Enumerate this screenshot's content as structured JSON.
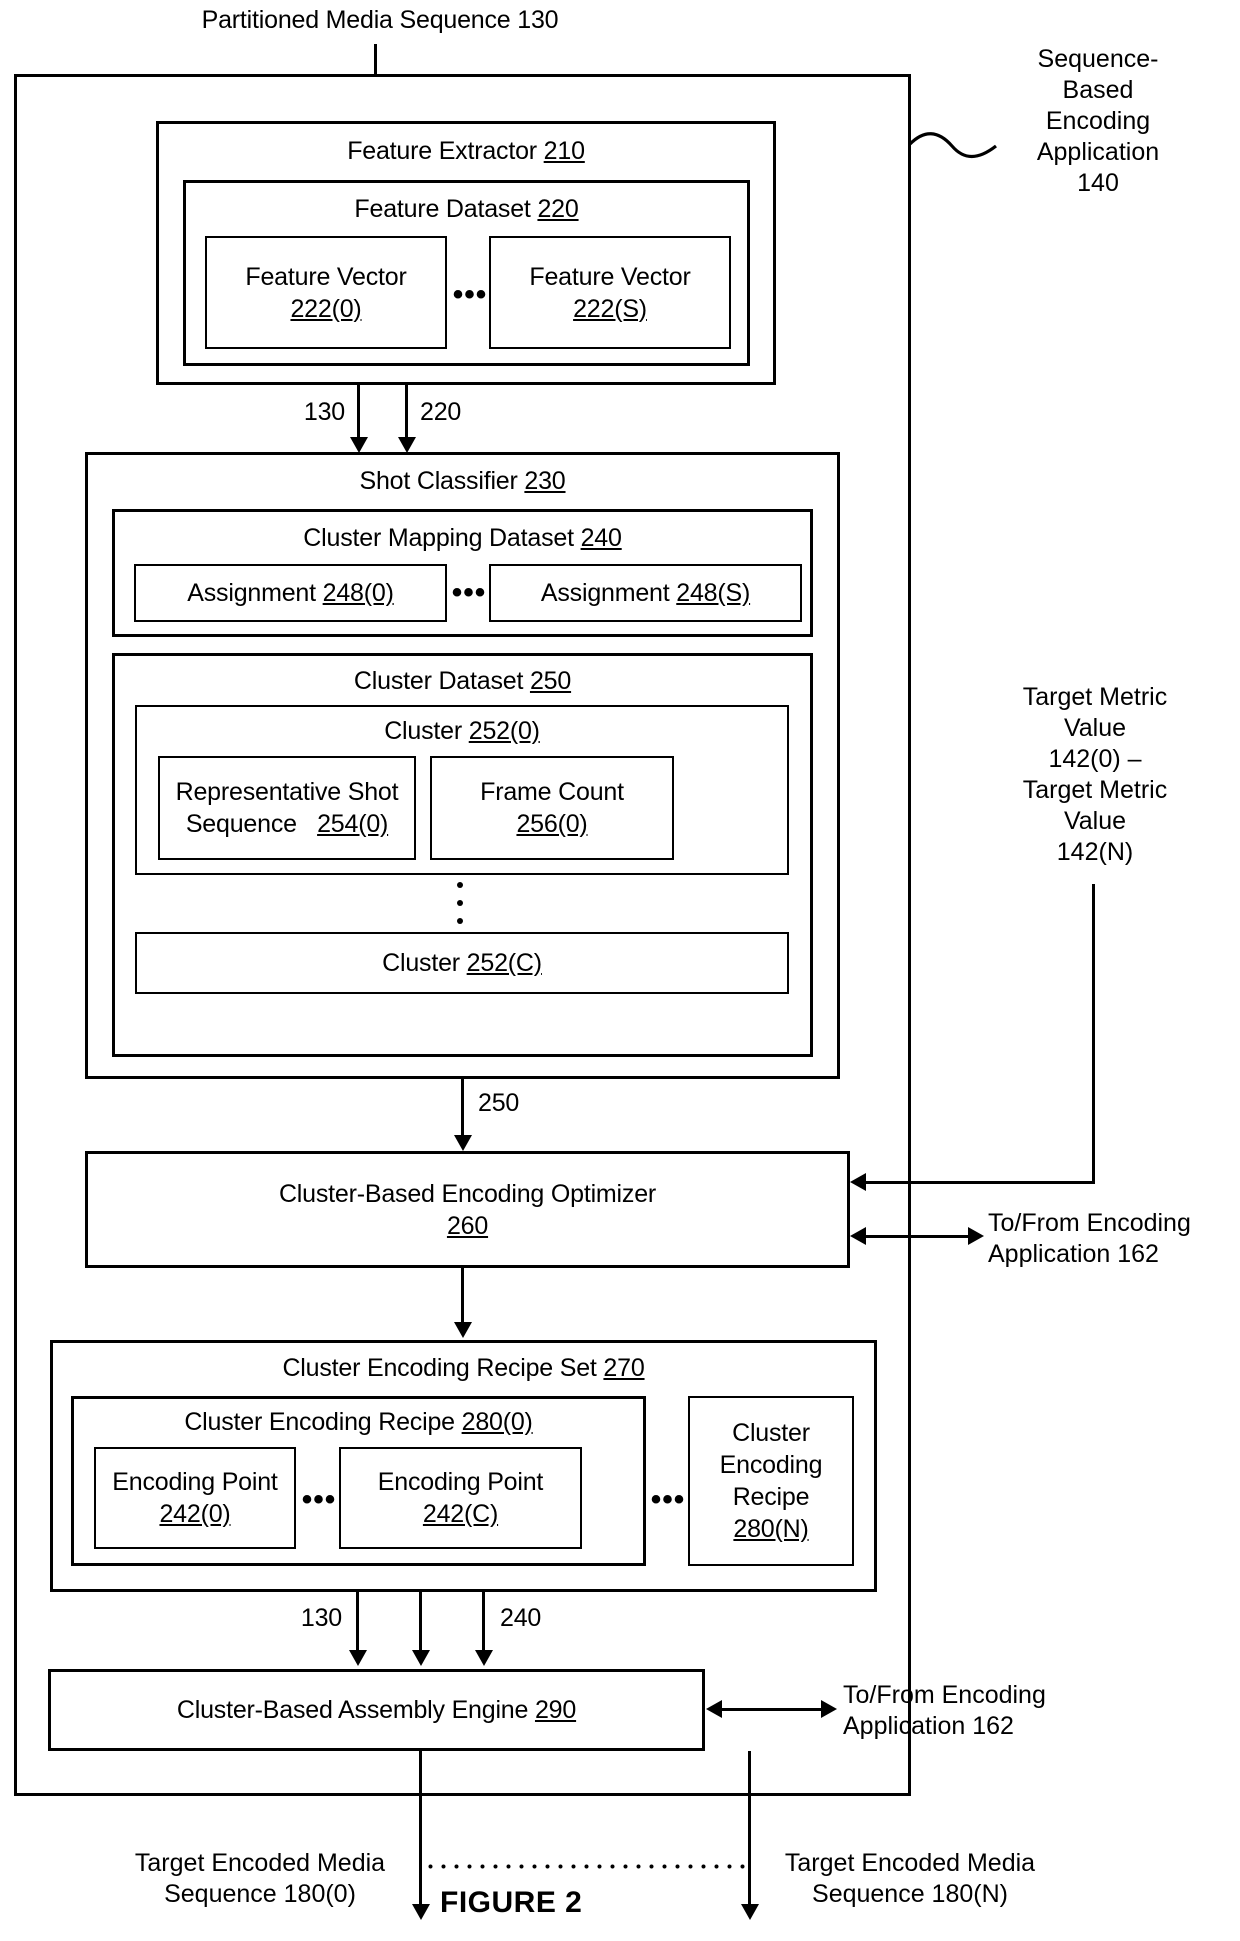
{
  "figure": {
    "caption": "FIGURE 2"
  },
  "inputs": {
    "top_label": "Partitioned Media Sequence 130"
  },
  "outer": {
    "callout_line1": "Sequence-",
    "callout_line2": "Based",
    "callout_line3": "Encoding",
    "callout_line4": "Application",
    "callout_line5": "140"
  },
  "feature_extractor": {
    "title": "Feature Extractor",
    "ref": "210",
    "dataset": {
      "title": "Feature Dataset",
      "ref": "220",
      "vectors": [
        {
          "title": "Feature Vector",
          "ref": "222(0)"
        },
        {
          "title": "Feature Vector",
          "ref": "222(S)"
        }
      ],
      "ellipsis": "•••"
    }
  },
  "edges": {
    "fe_to_sc_left": "130",
    "fe_to_sc_right": "220",
    "sc_to_opt": "250",
    "recipe_to_assembly_left": "130",
    "recipe_to_assembly_right": "240"
  },
  "shot_classifier": {
    "title": "Shot Classifier",
    "ref": "230",
    "mapping_dataset": {
      "title": "Cluster Mapping Dataset",
      "ref": "240",
      "assignments": [
        {
          "title": "Assignment",
          "ref": "248(0)"
        },
        {
          "title": "Assignment",
          "ref": "248(S)"
        }
      ],
      "ellipsis": "•••"
    },
    "cluster_dataset": {
      "title": "Cluster Dataset",
      "ref": "250",
      "cluster_first": {
        "title": "Cluster",
        "ref": "252(0)",
        "representative_shot_sequence": {
          "line1": "Representative Shot",
          "line2": "Sequence",
          "ref": "254(0)"
        },
        "frame_count": {
          "line1": "Frame Count",
          "ref": "256(0)"
        }
      },
      "vertical_ellipsis": "⋮",
      "cluster_last": {
        "title": "Cluster",
        "ref": "252(C)"
      }
    }
  },
  "target_metric": {
    "line1": "Target Metric",
    "line2": "Value",
    "line3": "142(0) –",
    "line4": "Target Metric",
    "line5": "Value",
    "line6": "142(N)"
  },
  "optimizer": {
    "title": "Cluster-Based Encoding Optimizer",
    "ref": "260",
    "external_io_line1": "To/From Encoding",
    "external_io_line2": "Application 162"
  },
  "recipe_set": {
    "title": "Cluster Encoding Recipe Set",
    "ref": "270",
    "recipe_first": {
      "title": "Cluster Encoding Recipe",
      "ref": "280(0)",
      "points": [
        {
          "title": "Encoding Point",
          "ref": "242(0)"
        },
        {
          "title": "Encoding Point",
          "ref": "242(C)"
        }
      ],
      "ellipsis": "•••"
    },
    "outer_ellipsis": "•••",
    "recipe_last": {
      "line1": "Cluster",
      "line2": "Encoding",
      "line3": "Recipe",
      "ref": "280(N)"
    }
  },
  "assembly_engine": {
    "title": "Cluster-Based Assembly Engine",
    "ref": "290",
    "external_io_line1": "To/From Encoding",
    "external_io_line2": "Application 162"
  },
  "outputs": {
    "left_line1": "Target Encoded Media",
    "left_line2": "Sequence 180(0)",
    "right_line1": "Target Encoded Media",
    "right_line2": "Sequence 180(N)"
  }
}
